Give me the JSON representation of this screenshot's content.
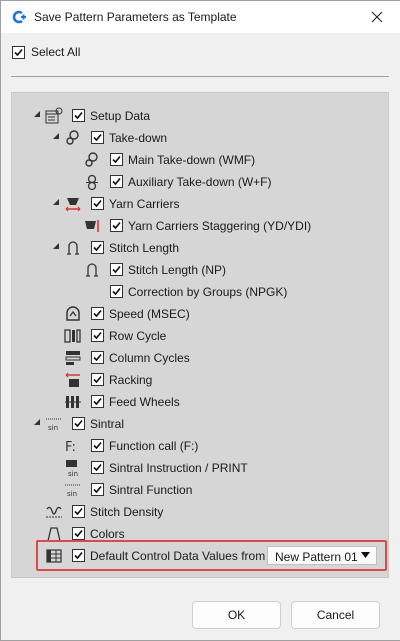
{
  "window": {
    "title": "Save Pattern Parameters as Template",
    "accent_color": "#1a73e8"
  },
  "select_all": {
    "label": "Select All",
    "checked": true
  },
  "tree": {
    "setup_data": "Setup Data",
    "take_down": "Take-down",
    "main_take_down": "Main Take-down (WMF)",
    "aux_take_down": "Auxiliary Take-down (W+F)",
    "yarn_carriers": "Yarn Carriers",
    "yarn_staggering": "Yarn Carriers Staggering (YD/YDI)",
    "stitch_length": "Stitch Length",
    "stitch_length_np": "Stitch Length (NP)",
    "correction_groups": "Correction by Groups (NPGK)",
    "speed": "Speed (MSEC)",
    "row_cycle": "Row Cycle",
    "column_cycles": "Column Cycles",
    "racking": "Racking",
    "feed_wheels": "Feed Wheels",
    "sintral": "Sintral",
    "function_call": "Function call (F:)",
    "sintral_instruction": "Sintral Instruction / PRINT",
    "sintral_function": "Sintral Function",
    "stitch_density": "Stitch Density",
    "colors": "Colors",
    "default_control": "Default Control Data Values from"
  },
  "icons": {
    "setup_data": "gear-grid",
    "take_down": "roller",
    "yarn_carriers": "carrier",
    "stitch_length": "stitch-loop",
    "speed": "speed",
    "row_cycle": "row-cycle",
    "column_cycles": "column-cycle",
    "racking": "racking",
    "feed_wheels": "feed-wheels",
    "sintral": "sin-text",
    "function_call": "function",
    "stitch_density": "density",
    "colors": "colors",
    "default_control": "table"
  },
  "dropdown": {
    "selected": "New Pattern 01"
  },
  "buttons": {
    "ok": "OK",
    "cancel": "Cancel"
  },
  "highlight_color": "#e04848"
}
